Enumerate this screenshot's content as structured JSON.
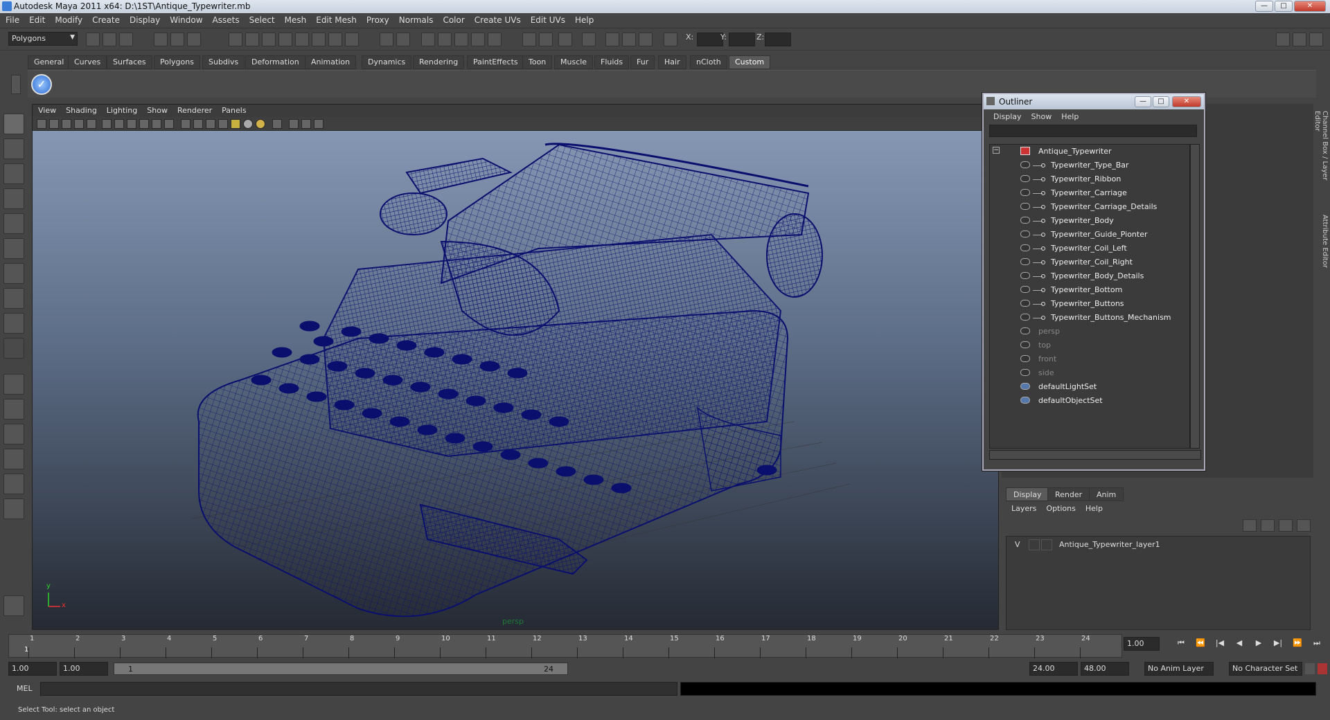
{
  "window": {
    "title": "Autodesk Maya 2011 x64: D:\\1ST\\Antique_Typewriter.mb",
    "min": "—",
    "max": "□",
    "close": "✕"
  },
  "menu": [
    "File",
    "Edit",
    "Modify",
    "Create",
    "Display",
    "Window",
    "Assets",
    "Select",
    "Mesh",
    "Edit Mesh",
    "Proxy",
    "Normals",
    "Color",
    "Create UVs",
    "Edit UVs",
    "Help"
  ],
  "toolbar": {
    "mode": "Polygons",
    "x_label": "X:",
    "y_label": "Y:",
    "z_label": "Z:"
  },
  "shelf_tabs": [
    "General",
    "Curves",
    "Surfaces",
    "Polygons",
    "Subdivs",
    "Deformation",
    "Animation",
    "Dynamics",
    "Rendering",
    "PaintEffects",
    "Toon",
    "Muscle",
    "Fluids",
    "Fur",
    "Hair",
    "nCloth",
    "Custom"
  ],
  "shelf_active": "Custom",
  "viewport": {
    "menu": [
      "View",
      "Shading",
      "Lighting",
      "Show",
      "Renderer",
      "Panels"
    ],
    "camera_label": "persp",
    "axis_y": "y",
    "axis_x": "x",
    "wire_color": "#0a0f6e"
  },
  "outliner": {
    "title": "Outliner",
    "menu": [
      "Display",
      "Show",
      "Help"
    ],
    "root": "Antique_Typewriter",
    "children": [
      "Typewriter_Type_Bar",
      "Typewriter_Ribbon",
      "Typewriter_Carriage",
      "Typewriter_Carriage_Details",
      "Typewriter_Body",
      "Typewriter_Guide_Pionter",
      "Typewriter_Coil_Left",
      "Typewriter_Coil_Right",
      "Typewriter_Body_Details",
      "Typewriter_Bottom",
      "Typewriter_Buttons",
      "Typewriter_Buttons_Mechanism"
    ],
    "cameras": [
      "persp",
      "top",
      "front",
      "side"
    ],
    "sets": [
      "defaultLightSet",
      "defaultObjectSet"
    ]
  },
  "side_tabs": [
    "Channel Box / Layer Editor",
    "Attribute Editor"
  ],
  "layer_editor": {
    "tabs": [
      "Display",
      "Render",
      "Anim"
    ],
    "active": "Display",
    "menu": [
      "Layers",
      "Options",
      "Help"
    ],
    "layer_v": "V",
    "layer_name": "Antique_Typewriter_layer1"
  },
  "timeline": {
    "ticks": [
      "1",
      "2",
      "3",
      "4",
      "5",
      "6",
      "7",
      "8",
      "9",
      "10",
      "11",
      "12",
      "13",
      "14",
      "15",
      "16",
      "17",
      "18",
      "19",
      "20",
      "21",
      "22",
      "23",
      "24"
    ],
    "current_marker": "1",
    "current_frame": "1.00"
  },
  "playback": [
    "⏮",
    "⏪",
    "|◀",
    "◀",
    "▶",
    "▶|",
    "⏩",
    "⏭"
  ],
  "range": {
    "start": "1.00",
    "start2": "1.00",
    "slider_start": "1",
    "slider_end": "24",
    "end": "24.00",
    "end2": "48.00",
    "anim_layer": "No Anim Layer",
    "char_set": "No Character Set"
  },
  "mel": {
    "label": "MEL"
  },
  "status": "Select Tool: select an object"
}
